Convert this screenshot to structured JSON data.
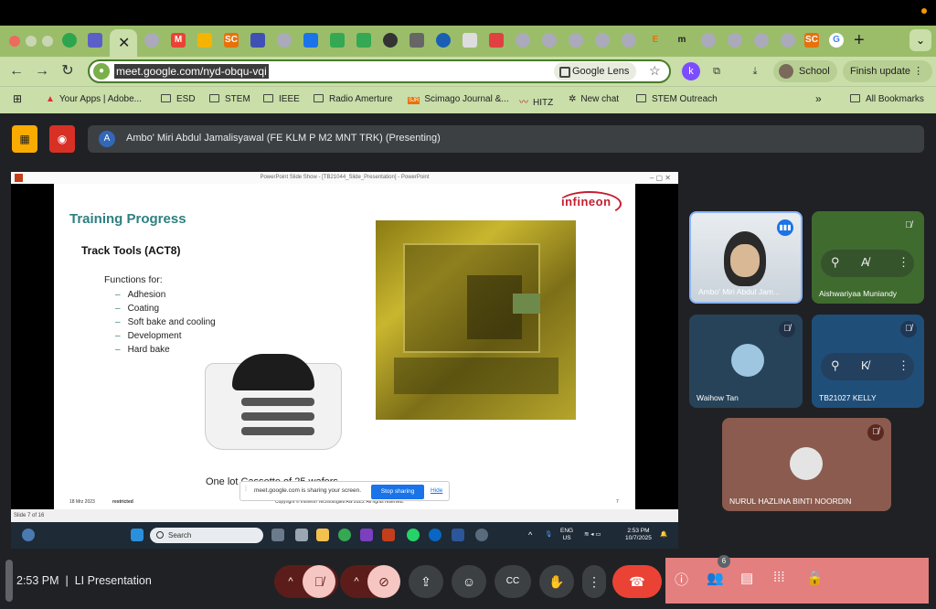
{
  "browser": {
    "url": "meet.google.com/nyd-obqu-vqi",
    "lens_label": "Google Lens",
    "profile_label": "School",
    "finish_update_label": "Finish update",
    "bookmarks": [
      "Your Apps | Adobe...",
      "ESD",
      "STEM",
      "IEEE",
      "Radio Amerture",
      "Scimago Journal &...",
      "HITZ",
      "New chat",
      "STEM Outreach"
    ],
    "all_bookmarks_label": "All Bookmarks"
  },
  "meet": {
    "presenting_label": "Ambo' Miri Abdul Jamalisyawal (FE KLM P M2 MNT TRK) (Presenting)",
    "presenter_initial": "A",
    "time": "2:53 PM",
    "meeting_name": "LI Presentation",
    "participant_count": "6",
    "participants": [
      {
        "name": "Ambo' Miri Abdul Jam..."
      },
      {
        "name": "Aishwariyaa Muniandy"
      },
      {
        "name": "Waihow Tan"
      },
      {
        "name": "TB21027 KELLY"
      },
      {
        "name": "NURUL HAZLINA BINTI NOORDIN"
      }
    ],
    "colors": {
      "accent_panel": "#e37f7f",
      "end_call": "#ea4335"
    }
  },
  "shared_screen": {
    "window_title": "PowerPoint Slide Show - [TB21044_Slide_Presentation] - PowerPoint",
    "slide": {
      "title": "Training Progress",
      "subtitle": "Track Tools (ACT8)",
      "functions_label": "Functions for:",
      "functions": [
        "Adhesion",
        "Coating",
        "Soft bake and cooling",
        "Development",
        "Hard bake"
      ],
      "logo": "infineon",
      "caption": "One lot Cassette of 25 wafers",
      "footer_date": "18 Mrz 2023",
      "footer_class": "restricted",
      "footer_copyright": "Copyright © Infineon Technologies AG 2023. All rights reserved.",
      "page_number": "7"
    },
    "share_notice": "meet.google.com is sharing your screen.",
    "stop_sharing_label": "Stop sharing",
    "hide_label": "Hide",
    "status_bar": "Slide 7 of 16",
    "taskbar": {
      "search_placeholder": "Search",
      "lang_1": "ENG",
      "lang_2": "US",
      "time": "2:53 PM",
      "date": "10/7/2025"
    }
  }
}
